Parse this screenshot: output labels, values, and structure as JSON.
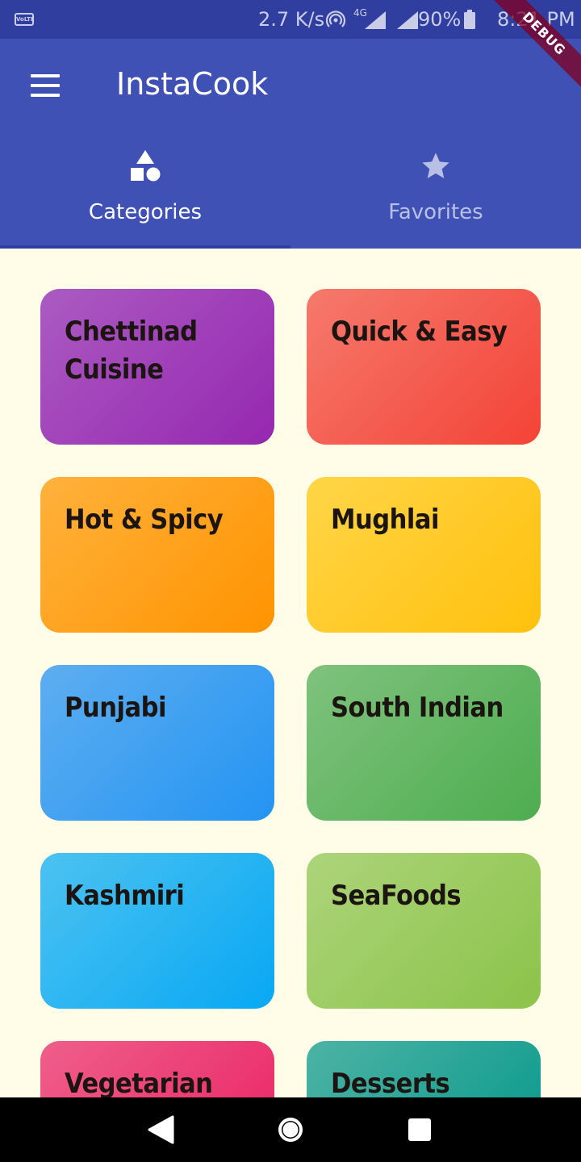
{
  "status_bar": {
    "volte": "VoLTE",
    "network_speed": "2.7 K/s",
    "network_type": "4G",
    "battery_percent": "90%",
    "time": "8:21 PM"
  },
  "app_bar": {
    "title": "InstaCook",
    "debug_banner": "DEBUG"
  },
  "tabs": [
    {
      "label": "Categories",
      "icon": "category-shapes-icon",
      "active": true
    },
    {
      "label": "Favorites",
      "icon": "star-icon",
      "active": false
    }
  ],
  "categories": [
    {
      "title": "Chettinad Cuisine",
      "color_from": "#AB5BC2",
      "color_to": "#9627B0"
    },
    {
      "title": "Quick & Easy",
      "color_from": "#F57A6D",
      "color_to": "#F44336"
    },
    {
      "title": "Hot & Spicy",
      "color_from": "#FFB23C",
      "color_to": "#FF9300"
    },
    {
      "title": "Mughlai",
      "color_from": "#FFD547",
      "color_to": "#FFC10D"
    },
    {
      "title": "Punjabi",
      "color_from": "#5EAEF0",
      "color_to": "#2394F2"
    },
    {
      "title": "South Indian",
      "color_from": "#7FC27E",
      "color_to": "#4EAD4F"
    },
    {
      "title": "Kashmiri",
      "color_from": "#4CC2F0",
      "color_to": "#08A8F4"
    },
    {
      "title": "SeaFoods",
      "color_from": "#ADD47A",
      "color_to": "#8BC34A"
    },
    {
      "title": "Vegetarian",
      "color_from": "#EF5F8B",
      "color_to": "#E91E63"
    },
    {
      "title": "Desserts",
      "color_from": "#4DB3A5",
      "color_to": "#009688"
    }
  ],
  "navigation": {
    "back": "back-icon",
    "home": "home-icon",
    "recents": "recents-icon"
  }
}
